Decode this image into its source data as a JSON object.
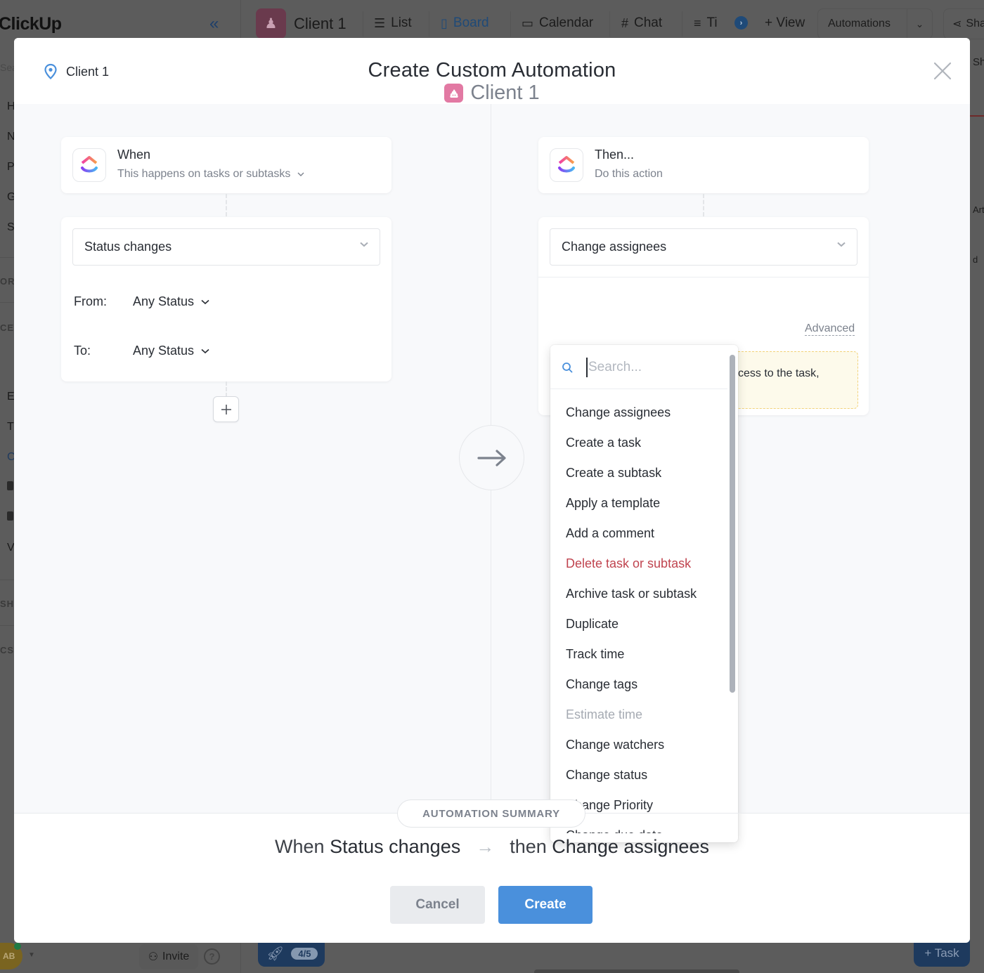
{
  "background": {
    "logo": "ClickUp",
    "space_name": "Client 1",
    "tabs": [
      {
        "label": "List",
        "icon": "list-icon"
      },
      {
        "label": "Board",
        "icon": "board-icon",
        "active": true
      },
      {
        "label": "Calendar",
        "icon": "calendar-icon"
      },
      {
        "label": "Chat",
        "icon": "hash-icon"
      },
      {
        "label": "Ti",
        "icon": "timeline-icon"
      }
    ],
    "add_view_label": "+ View",
    "automations_label": "Automations",
    "share_label": "Sha",
    "sidebar_letters": [
      "H",
      "N",
      "P",
      "G",
      "S",
      "E",
      "T",
      "C",
      "V"
    ],
    "sidebar_sections": [
      "OR",
      "CE",
      "SHE",
      "CS"
    ],
    "sidebar_search": "Sea",
    "right_texts": [
      "Sh",
      "Arti",
      "d"
    ],
    "avatar_initials": "AB",
    "invite_label": "Invite",
    "help_label": "?",
    "onboarding_progress": "4/5",
    "task_button_label": "+ Task"
  },
  "modal": {
    "location_label": "Client 1",
    "title": "Create Custom Automation",
    "subtitle_space": "Client 1",
    "when_card": {
      "title": "When",
      "subtitle": "This happens on tasks or subtasks"
    },
    "trigger": {
      "selected": "Status changes",
      "from_label": "From:",
      "from_value": "Any Status",
      "to_label": "To:",
      "to_value": "Any Status"
    },
    "then_card": {
      "title": "Then...",
      "subtitle": "Do this action"
    },
    "action": {
      "selected": "Change assignees",
      "advanced_label": "Advanced",
      "warning_text_partial": "cess to the task,"
    },
    "dropdown": {
      "search_placeholder": "Search...",
      "search_value": "",
      "items": [
        {
          "label": "Change assignees",
          "state": "normal"
        },
        {
          "label": "Create a task",
          "state": "normal"
        },
        {
          "label": "Create a subtask",
          "state": "normal"
        },
        {
          "label": "Apply a template",
          "state": "normal"
        },
        {
          "label": "Add a comment",
          "state": "normal"
        },
        {
          "label": "Delete task or subtask",
          "state": "danger"
        },
        {
          "label": "Archive task or subtask",
          "state": "normal"
        },
        {
          "label": "Duplicate",
          "state": "normal"
        },
        {
          "label": "Track time",
          "state": "normal"
        },
        {
          "label": "Change tags",
          "state": "normal"
        },
        {
          "label": "Estimate time",
          "state": "disabled"
        },
        {
          "label": "Change watchers",
          "state": "normal"
        },
        {
          "label": "Change status",
          "state": "normal"
        },
        {
          "label": "Change Priority",
          "state": "normal"
        },
        {
          "label": "Change due date",
          "state": "normal"
        }
      ]
    },
    "summary": {
      "pill_label": "AUTOMATION SUMMARY",
      "when_word": "When",
      "trigger": "Status changes",
      "then_word": "then",
      "action": "Change assignees"
    },
    "cancel_label": "Cancel",
    "create_label": "Create"
  },
  "colors": {
    "accent": "#4a90dc",
    "danger": "#c0444f",
    "space_pink": "#e279a3",
    "canvas": "#f8f9fb"
  }
}
